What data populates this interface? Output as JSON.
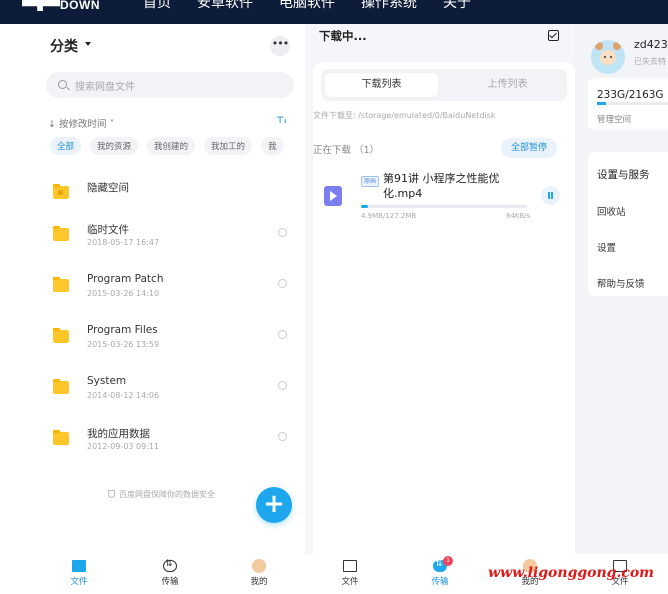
{
  "site": {
    "logo_text": "DOWN",
    "nav": [
      "首页",
      "安卓软件",
      "电脑软件",
      "操作系统",
      "关于"
    ]
  },
  "files_panel": {
    "title": "分类",
    "more_label": "•••",
    "search_placeholder": "搜索网盘文件",
    "sort_label": "按修改时间",
    "chips": [
      "全部",
      "我的资源",
      "我创建的",
      "我加工的",
      "我"
    ],
    "files": [
      {
        "name": "隐藏空间",
        "date": ""
      },
      {
        "name": "临时文件",
        "date": "2018-05-17  16:47"
      },
      {
        "name": "Program Patch",
        "date": "2015-03-26  14:10"
      },
      {
        "name": "Program Files",
        "date": "2015-03-26  13:59"
      },
      {
        "name": "System",
        "date": "2014-08-12  14:06"
      },
      {
        "name": "我的应用数据",
        "date": "2012-09-03  09:11"
      }
    ],
    "footer": "百度网盘保障你的数据安全",
    "fab_label": "+"
  },
  "transfer_panel": {
    "title": "下载中...",
    "tabs": {
      "download": "下载列表",
      "upload": "上传列表"
    },
    "path": "文件下载至: /storage/emulated/0/BaiduNetdisk",
    "in_progress": "正在下载 （1）",
    "pause_all": "全部暂停",
    "item": {
      "badge": "原画",
      "name": "第91讲  小程序之性能优化.mp4",
      "size": "4.9MB/127.2MB",
      "speed": "84KB/s",
      "progress": 0.04
    }
  },
  "me_panel": {
    "username": "zd423",
    "subtext": "已失去特",
    "quota": "233G/2163G",
    "quota_fraction": 0.11,
    "manage": "管理空间",
    "section": "设置与服务",
    "items": [
      "回收站",
      "设置",
      "帮助与反馈"
    ]
  },
  "tabbar1": [
    {
      "label": "文件",
      "active": true
    },
    {
      "label": "传输",
      "active": false
    },
    {
      "label": "我的",
      "active": false
    }
  ],
  "tabbar2": [
    {
      "label": "文件",
      "active": false
    },
    {
      "label": "传输",
      "active": true,
      "badge": "1"
    },
    {
      "label": "我的",
      "active": false
    }
  ],
  "tabbar3": [
    {
      "label": "文件",
      "active": false
    }
  ],
  "watermark": "www.ligonggong.com",
  "colors": {
    "accent": "#1ea7ec",
    "folder": "#ffc62c",
    "nav_bg": "#0d1c38"
  }
}
